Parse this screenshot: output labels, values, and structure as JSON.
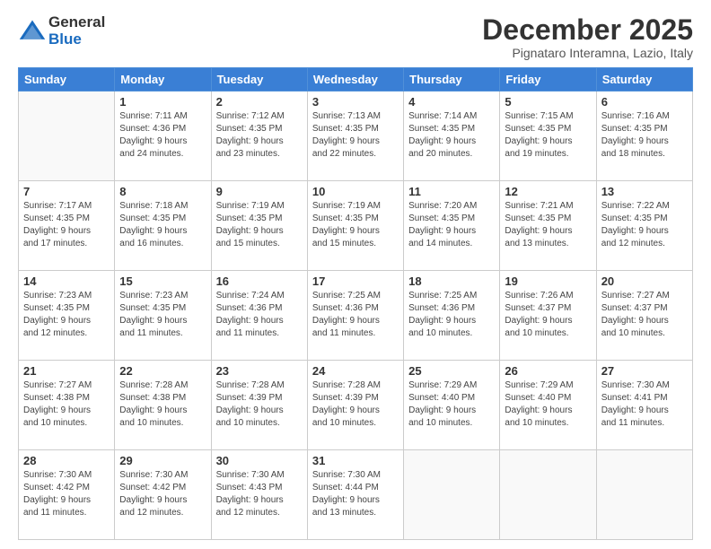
{
  "logo": {
    "general": "General",
    "blue": "Blue"
  },
  "title": "December 2025",
  "location": "Pignataro Interamna, Lazio, Italy",
  "days_header": [
    "Sunday",
    "Monday",
    "Tuesday",
    "Wednesday",
    "Thursday",
    "Friday",
    "Saturday"
  ],
  "weeks": [
    [
      {
        "num": "",
        "info": ""
      },
      {
        "num": "1",
        "info": "Sunrise: 7:11 AM\nSunset: 4:36 PM\nDaylight: 9 hours\nand 24 minutes."
      },
      {
        "num": "2",
        "info": "Sunrise: 7:12 AM\nSunset: 4:35 PM\nDaylight: 9 hours\nand 23 minutes."
      },
      {
        "num": "3",
        "info": "Sunrise: 7:13 AM\nSunset: 4:35 PM\nDaylight: 9 hours\nand 22 minutes."
      },
      {
        "num": "4",
        "info": "Sunrise: 7:14 AM\nSunset: 4:35 PM\nDaylight: 9 hours\nand 20 minutes."
      },
      {
        "num": "5",
        "info": "Sunrise: 7:15 AM\nSunset: 4:35 PM\nDaylight: 9 hours\nand 19 minutes."
      },
      {
        "num": "6",
        "info": "Sunrise: 7:16 AM\nSunset: 4:35 PM\nDaylight: 9 hours\nand 18 minutes."
      }
    ],
    [
      {
        "num": "7",
        "info": "Sunrise: 7:17 AM\nSunset: 4:35 PM\nDaylight: 9 hours\nand 17 minutes."
      },
      {
        "num": "8",
        "info": "Sunrise: 7:18 AM\nSunset: 4:35 PM\nDaylight: 9 hours\nand 16 minutes."
      },
      {
        "num": "9",
        "info": "Sunrise: 7:19 AM\nSunset: 4:35 PM\nDaylight: 9 hours\nand 15 minutes."
      },
      {
        "num": "10",
        "info": "Sunrise: 7:19 AM\nSunset: 4:35 PM\nDaylight: 9 hours\nand 15 minutes."
      },
      {
        "num": "11",
        "info": "Sunrise: 7:20 AM\nSunset: 4:35 PM\nDaylight: 9 hours\nand 14 minutes."
      },
      {
        "num": "12",
        "info": "Sunrise: 7:21 AM\nSunset: 4:35 PM\nDaylight: 9 hours\nand 13 minutes."
      },
      {
        "num": "13",
        "info": "Sunrise: 7:22 AM\nSunset: 4:35 PM\nDaylight: 9 hours\nand 12 minutes."
      }
    ],
    [
      {
        "num": "14",
        "info": "Sunrise: 7:23 AM\nSunset: 4:35 PM\nDaylight: 9 hours\nand 12 minutes."
      },
      {
        "num": "15",
        "info": "Sunrise: 7:23 AM\nSunset: 4:35 PM\nDaylight: 9 hours\nand 11 minutes."
      },
      {
        "num": "16",
        "info": "Sunrise: 7:24 AM\nSunset: 4:36 PM\nDaylight: 9 hours\nand 11 minutes."
      },
      {
        "num": "17",
        "info": "Sunrise: 7:25 AM\nSunset: 4:36 PM\nDaylight: 9 hours\nand 11 minutes."
      },
      {
        "num": "18",
        "info": "Sunrise: 7:25 AM\nSunset: 4:36 PM\nDaylight: 9 hours\nand 10 minutes."
      },
      {
        "num": "19",
        "info": "Sunrise: 7:26 AM\nSunset: 4:37 PM\nDaylight: 9 hours\nand 10 minutes."
      },
      {
        "num": "20",
        "info": "Sunrise: 7:27 AM\nSunset: 4:37 PM\nDaylight: 9 hours\nand 10 minutes."
      }
    ],
    [
      {
        "num": "21",
        "info": "Sunrise: 7:27 AM\nSunset: 4:38 PM\nDaylight: 9 hours\nand 10 minutes."
      },
      {
        "num": "22",
        "info": "Sunrise: 7:28 AM\nSunset: 4:38 PM\nDaylight: 9 hours\nand 10 minutes."
      },
      {
        "num": "23",
        "info": "Sunrise: 7:28 AM\nSunset: 4:39 PM\nDaylight: 9 hours\nand 10 minutes."
      },
      {
        "num": "24",
        "info": "Sunrise: 7:28 AM\nSunset: 4:39 PM\nDaylight: 9 hours\nand 10 minutes."
      },
      {
        "num": "25",
        "info": "Sunrise: 7:29 AM\nSunset: 4:40 PM\nDaylight: 9 hours\nand 10 minutes."
      },
      {
        "num": "26",
        "info": "Sunrise: 7:29 AM\nSunset: 4:40 PM\nDaylight: 9 hours\nand 10 minutes."
      },
      {
        "num": "27",
        "info": "Sunrise: 7:30 AM\nSunset: 4:41 PM\nDaylight: 9 hours\nand 11 minutes."
      }
    ],
    [
      {
        "num": "28",
        "info": "Sunrise: 7:30 AM\nSunset: 4:42 PM\nDaylight: 9 hours\nand 11 minutes."
      },
      {
        "num": "29",
        "info": "Sunrise: 7:30 AM\nSunset: 4:42 PM\nDaylight: 9 hours\nand 12 minutes."
      },
      {
        "num": "30",
        "info": "Sunrise: 7:30 AM\nSunset: 4:43 PM\nDaylight: 9 hours\nand 12 minutes."
      },
      {
        "num": "31",
        "info": "Sunrise: 7:30 AM\nSunset: 4:44 PM\nDaylight: 9 hours\nand 13 minutes."
      },
      {
        "num": "",
        "info": ""
      },
      {
        "num": "",
        "info": ""
      },
      {
        "num": "",
        "info": ""
      }
    ]
  ]
}
